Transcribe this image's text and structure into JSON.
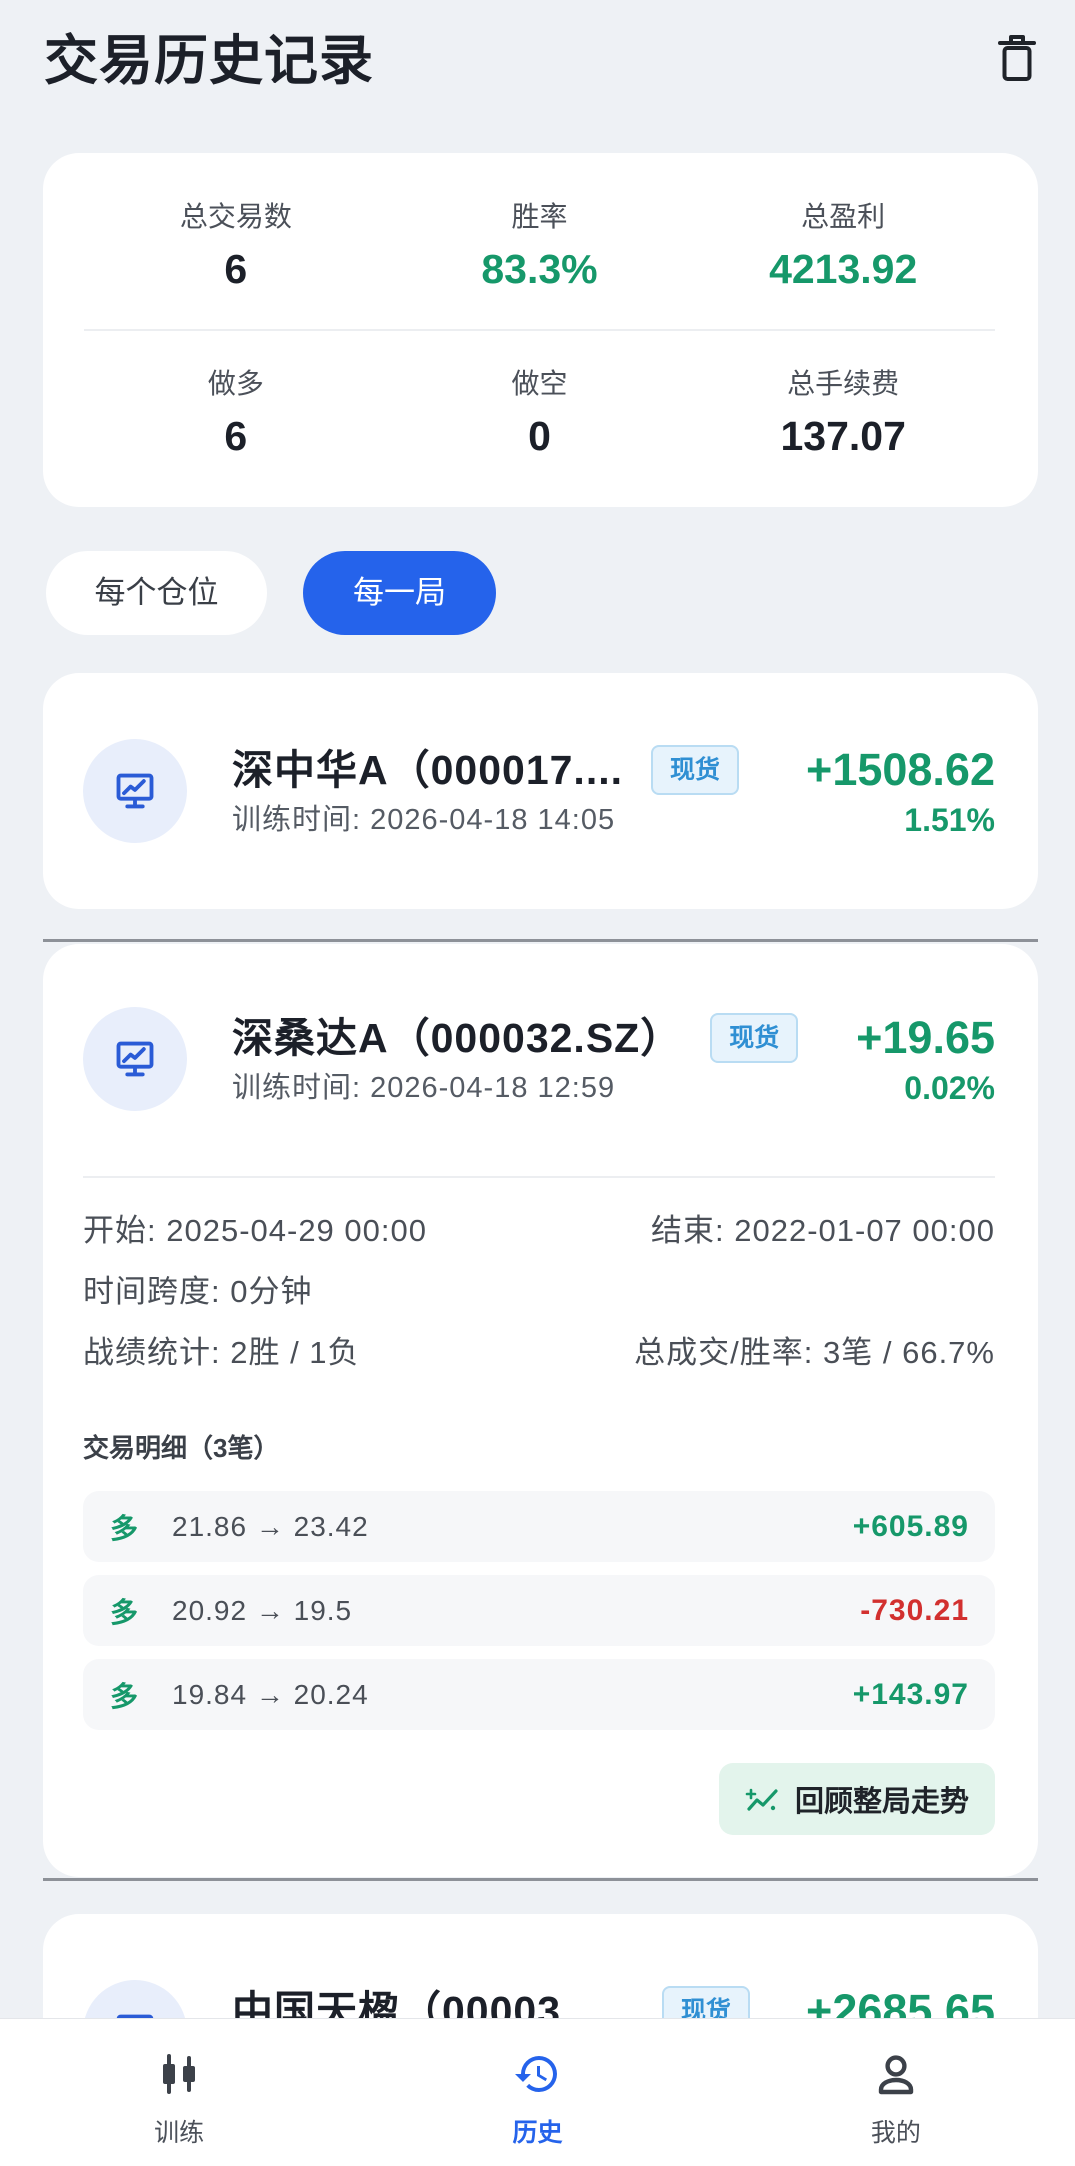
{
  "colors": {
    "accent": "#2563eb",
    "profit": "#16986a",
    "loss": "#d2302f",
    "background": "#eef1f5"
  },
  "header": {
    "title": "交易历史记录",
    "action_icon": "trash-icon"
  },
  "stats": {
    "total_trades": {
      "label": "总交易数",
      "value": "6"
    },
    "win_rate": {
      "label": "胜率",
      "value": "83.3%"
    },
    "total_profit": {
      "label": "总盈利",
      "value": "4213.92"
    },
    "long": {
      "label": "做多",
      "value": "6"
    },
    "short": {
      "label": "做空",
      "value": "0"
    },
    "total_fees": {
      "label": "总手续费",
      "value": "137.07"
    }
  },
  "tabs": [
    {
      "label": "每个仓位",
      "active": false
    },
    {
      "label": "每一局",
      "active": true
    }
  ],
  "records": [
    {
      "icon": "presentation-chart-icon",
      "title": "深中华A（000017....",
      "badge": "现货",
      "time": "训练时间: 2026-04-18 14:05",
      "pnl": "+1508.62",
      "return_pct": "1.51%"
    },
    {
      "icon": "presentation-chart-icon",
      "title": "深桑达A（000032.SZ）",
      "badge": "现货",
      "time": "训练时间: 2026-04-18 12:59",
      "pnl": "+19.65",
      "return_pct": "0.02%",
      "details": {
        "start": "开始: 2025-04-29 00:00",
        "end": "结束: 2022-01-07 00:00",
        "duration": "时间跨度: 0分钟",
        "win_loss": "战绩统计: 2胜 / 1负",
        "volume_win_rate": "总成交/胜率: 3笔 / 66.7%",
        "trades_title": "交易明细（3笔）",
        "trades": [
          {
            "side": "多",
            "prices": "21.86 → 23.42",
            "pnl": "+605.89"
          },
          {
            "side": "多",
            "prices": "20.92 → 19.5",
            "pnl": "-730.21"
          },
          {
            "side": "多",
            "prices": "19.84 → 20.24",
            "pnl": "+143.97"
          }
        ],
        "review_button": "回顾整局走势",
        "review_icon": "trend-chart-icon"
      }
    },
    {
      "icon": "presentation-chart-icon",
      "title": "中国天楹（00003",
      "badge": "现货",
      "pnl": "+2685.65"
    }
  ],
  "nav": [
    {
      "label": "训练",
      "icon": "candlestick-icon",
      "active": false
    },
    {
      "label": "历史",
      "icon": "history-icon",
      "active": true
    },
    {
      "label": "我的",
      "icon": "user-icon",
      "active": false
    }
  ]
}
